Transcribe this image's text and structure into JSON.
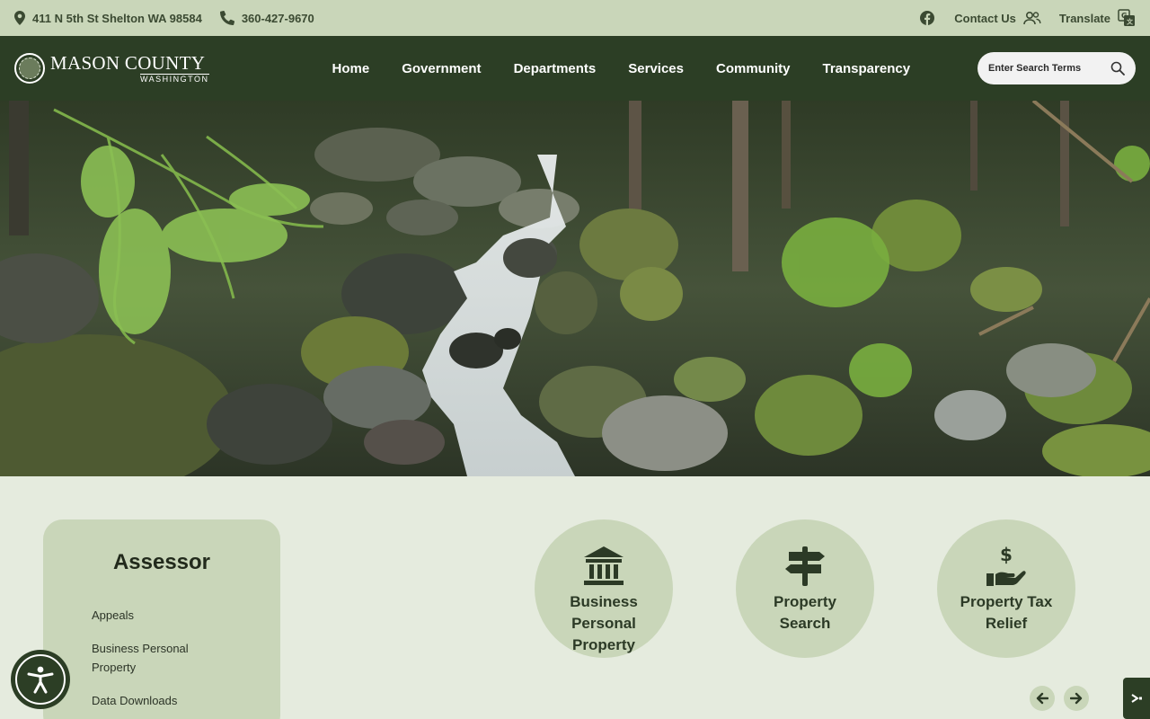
{
  "utility": {
    "address": "411 N 5th St Shelton WA 98584",
    "phone": "360-427-9670",
    "contact_label": "Contact Us",
    "translate_label": "Translate"
  },
  "header": {
    "logo_name": "MASON COUNTY",
    "logo_sub": "WASHINGTON",
    "nav": [
      "Home",
      "Government",
      "Departments",
      "Services",
      "Community",
      "Transparency"
    ],
    "search_placeholder": "Enter Search Terms"
  },
  "sidebar": {
    "title": "Assessor",
    "links": [
      "Appeals",
      "Business Personal Property",
      "Data Downloads"
    ]
  },
  "quick_links": [
    {
      "label": "Business Personal Property",
      "icon": "bank-icon"
    },
    {
      "label": "Property Search",
      "icon": "signpost-icon"
    },
    {
      "label": "Property Tax Relief",
      "icon": "hand-dollar-icon"
    }
  ],
  "colors": {
    "utility_bg": "#c9d6b9",
    "header_bg": "#2c3e25",
    "page_bg": "#e5ebde",
    "card_bg": "#c9d6b9"
  }
}
